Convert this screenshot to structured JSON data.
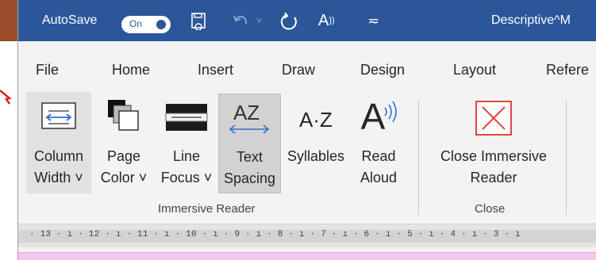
{
  "titlebar": {
    "autosave_label": "AutoSave",
    "autosave_state": "On",
    "document_title": "Descriptive^M",
    "icons": [
      "save-icon",
      "undo-icon",
      "redo-icon",
      "read-aloud-icon",
      "customize-icon"
    ]
  },
  "tabs": [
    "File",
    "Home",
    "Insert",
    "Draw",
    "Design",
    "Layout",
    "Refere"
  ],
  "ribbon": {
    "groups": [
      {
        "label": "Immersive Reader",
        "buttons": [
          {
            "line1": "Column",
            "line2": "Width ˅",
            "icon": "column-width-icon"
          },
          {
            "line1": "Page",
            "line2": "Color ˅",
            "icon": "page-color-icon"
          },
          {
            "line1": "Line",
            "line2": "Focus ˅",
            "icon": "line-focus-icon"
          },
          {
            "line1": "Text",
            "line2": "Spacing",
            "icon": "text-spacing-icon"
          },
          {
            "line1": "Syllables",
            "line2": "",
            "icon": "syllables-icon",
            "glyph": "A·Z"
          },
          {
            "line1": "Read",
            "line2": "Aloud",
            "icon": "read-aloud-icon",
            "glyph": "A"
          }
        ]
      },
      {
        "label": "Close",
        "buttons": [
          {
            "line1": "Close Immersive",
            "line2": "Reader",
            "icon": "close-icon"
          }
        ]
      }
    ]
  },
  "ruler": {
    "text": "· 13 · ı · 12 · ı · 11 · ı · 10 · ı · 9 · ı · 8 · ı · 7 · ı · 6 · ı · 5 · ı · 4 · ı · 3 · ı"
  },
  "colors": {
    "titlebar": "#2b579a",
    "close_icon": "#e03030",
    "page_tint": "#f4c6f0",
    "arrow": "#e02020"
  }
}
